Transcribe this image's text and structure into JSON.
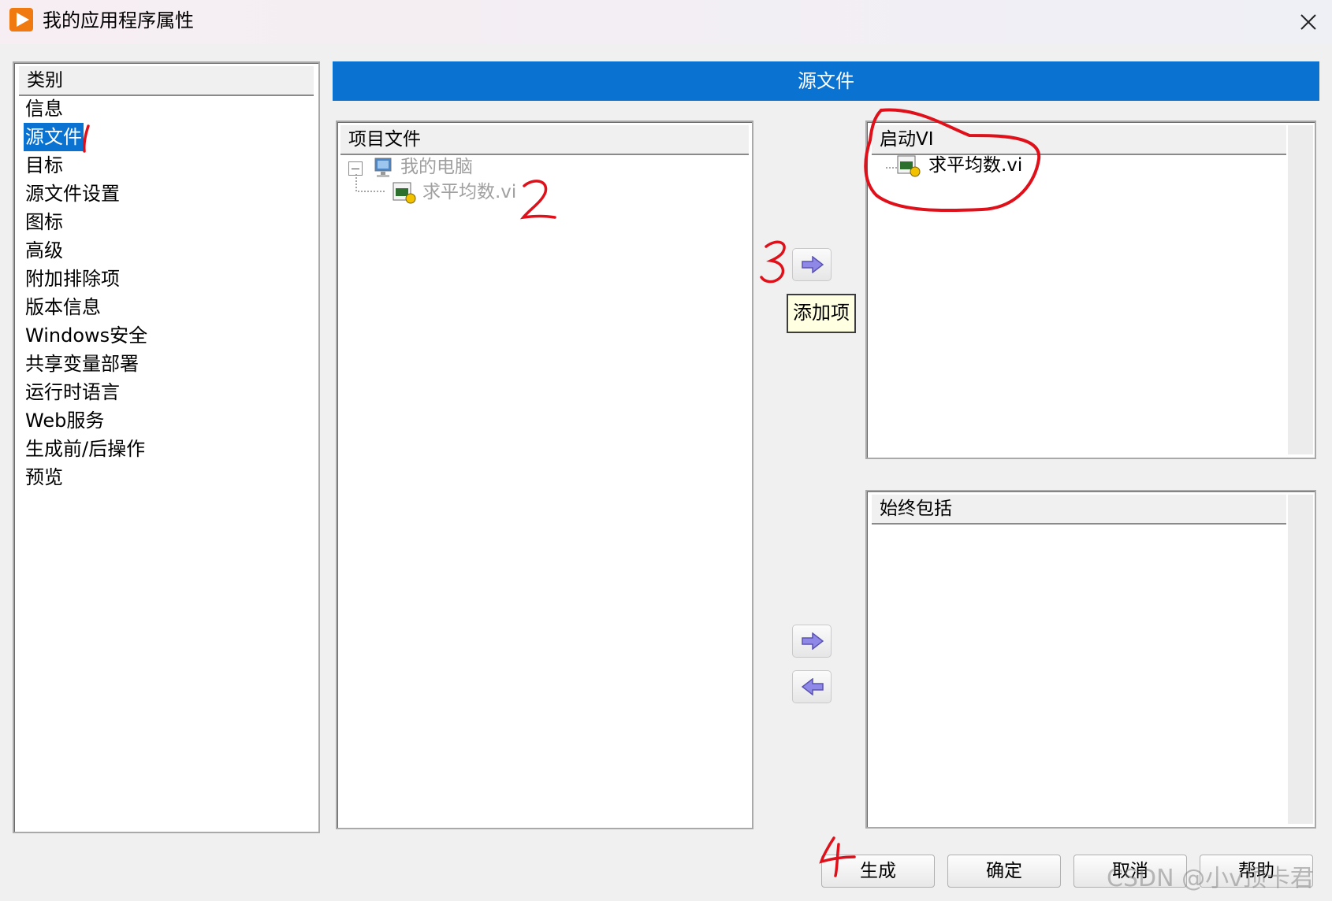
{
  "window": {
    "title": "我的应用程序属性",
    "app_icon": "play-icon",
    "close_icon": "close-icon"
  },
  "category": {
    "header": "类别",
    "items": [
      "信息",
      "源文件",
      "目标",
      "源文件设置",
      "图标",
      "高级",
      "附加排除项",
      "版本信息",
      "Windows安全",
      "共享变量部署",
      "运行时语言",
      "Web服务",
      "生成前/后操作",
      "预览"
    ],
    "selected": "源文件"
  },
  "section": {
    "title": "源文件"
  },
  "project_files": {
    "header": "项目文件",
    "tree": {
      "root": "我的电脑",
      "child": "求平均数.vi"
    }
  },
  "startup_vi": {
    "header": "启动VI",
    "items": [
      "求平均数.vi"
    ]
  },
  "always_include": {
    "header": "始终包括",
    "items": []
  },
  "add_tooltip": "添加项",
  "buttons": {
    "build": "生成",
    "ok": "确定",
    "cancel": "取消",
    "help": "帮助"
  },
  "annotations": [
    "1",
    "2",
    "3",
    "4"
  ],
  "watermark": "CSDN @小v顶卡君",
  "colors": {
    "accent": "#0a73d2",
    "annotation": "#e0101a",
    "disabled_text": "#a0a0a0"
  }
}
